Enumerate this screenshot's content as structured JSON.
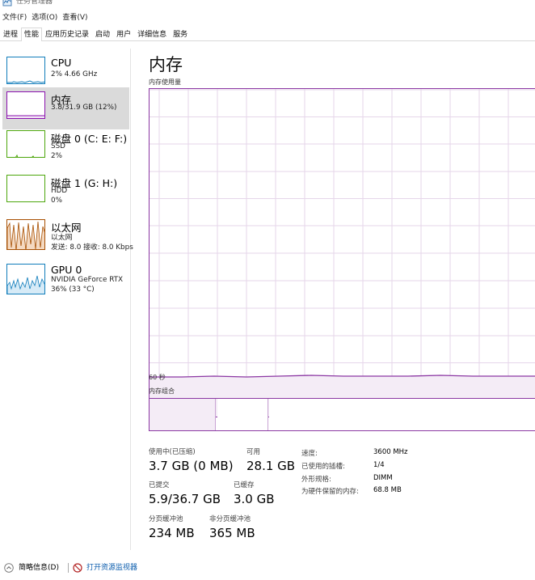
{
  "window": {
    "title": "任务管理器"
  },
  "menu": [
    {
      "label": "文件(F)"
    },
    {
      "label": "选项(O)"
    },
    {
      "label": "查看(V)"
    }
  ],
  "tabs": [
    {
      "label": "进程"
    },
    {
      "label": "性能",
      "active": true
    },
    {
      "label": "应用历史记录"
    },
    {
      "label": "启动"
    },
    {
      "label": "用户"
    },
    {
      "label": "详细信息"
    },
    {
      "label": "服务"
    }
  ],
  "sidebar": {
    "items": [
      {
        "name": "CPU",
        "line1": "2% 4.66 GHz",
        "line2": "",
        "color": "#117dbb"
      },
      {
        "name": "内存",
        "line1": "3.8/31.9 GB (12%)",
        "line2": "",
        "color": "#8b12ae",
        "selected": true
      },
      {
        "name": "磁盘 0 (C: E: F:)",
        "line1": "SSD",
        "line2": "2%",
        "color": "#4da60c"
      },
      {
        "name": "磁盘 1 (G: H:)",
        "line1": "HDD",
        "line2": "0%",
        "color": "#4da60c"
      },
      {
        "name": "以太网",
        "line1": "以太网",
        "line2": "发送: 8.0  接收: 8.0 Kbps",
        "color": "#a74f01"
      },
      {
        "name": "GPU 0",
        "line1": "NVIDIA GeForce RTX",
        "line2": "36% (33 °C)",
        "color": "#117dbb"
      }
    ]
  },
  "main": {
    "title": "内存",
    "usage_label": "内存使用量",
    "time_label": "60 秒",
    "composition_label": "内存组合",
    "accent_color": "#8b37a3",
    "usage_fraction": 0.12,
    "stats": {
      "in_use_label": "使用中(已压缩)",
      "in_use_value": "3.7 GB (0 MB)",
      "available_label": "可用",
      "available_value": "28.1 GB",
      "committed_label": "已提交",
      "committed_value": "5.9/36.7 GB",
      "cached_label": "已缓存",
      "cached_value": "3.0 GB",
      "paged_label": "分页缓冲池",
      "paged_value": "234 MB",
      "nonpaged_label": "非分页缓冲池",
      "nonpaged_value": "365 MB"
    },
    "specs": {
      "speed_label": "速度:",
      "speed_value": "3600 MHz",
      "slots_label": "已使用的插槽:",
      "slots_value": "1/4",
      "form_label": "外形规格:",
      "form_value": "DIMM",
      "reserved_label": "为硬件保留的内存:",
      "reserved_value": "68.8 MB"
    }
  },
  "footer": {
    "summary_label": "简略信息(D)",
    "monitor_link": "打开资源监视器"
  }
}
